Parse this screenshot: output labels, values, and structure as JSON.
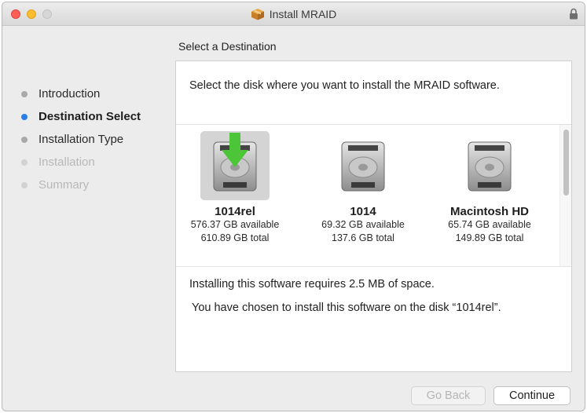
{
  "window": {
    "title": "Install MRAID",
    "title_icon": "package-icon",
    "lock_icon": "lock-icon"
  },
  "heading": "Select a Destination",
  "steps": [
    {
      "label": "Introduction",
      "state": "done"
    },
    {
      "label": "Destination Select",
      "state": "current"
    },
    {
      "label": "Installation Type",
      "state": "done"
    },
    {
      "label": "Installation",
      "state": "pending"
    },
    {
      "label": "Summary",
      "state": "pending"
    }
  ],
  "prompt": "Select the disk where you want to install the MRAID software.",
  "disks": [
    {
      "name": "1014rel",
      "available": "576.37 GB available",
      "total": "610.89 GB total",
      "selected": true
    },
    {
      "name": "1014",
      "available": "69.32 GB available",
      "total": "137.6 GB total",
      "selected": false
    },
    {
      "name": "Macintosh HD",
      "available": "65.74 GB available",
      "total": "149.89 GB total",
      "selected": false
    }
  ],
  "space_text": "Installing this software requires 2.5 MB of space.",
  "chosen_text": "You have chosen to install this software on the disk “1014rel”.",
  "buttons": {
    "back": "Go Back",
    "continue": "Continue"
  },
  "colors": {
    "accent": "#2b7de9",
    "close": "#ff5f57",
    "minimize": "#ffbd2e",
    "arrow": "#4cc538"
  }
}
